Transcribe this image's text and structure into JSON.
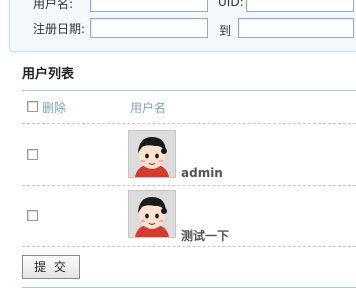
{
  "filters": {
    "username_label": "用户名:",
    "username_value": "",
    "uid_label": "UID:",
    "uid_value": "",
    "regdate_label": "注册日期:",
    "regdate_from": "",
    "to_label": "到",
    "regdate_to": ""
  },
  "section_title": "用户列表",
  "table": {
    "col_delete": "删除",
    "col_username": "用户名",
    "rows": [
      {
        "username": "admin",
        "avatar_icon": "cartoon-boy-avatar"
      },
      {
        "username": "测试一下",
        "avatar_icon": "cartoon-boy-avatar"
      }
    ]
  },
  "submit_label": "提 交"
}
